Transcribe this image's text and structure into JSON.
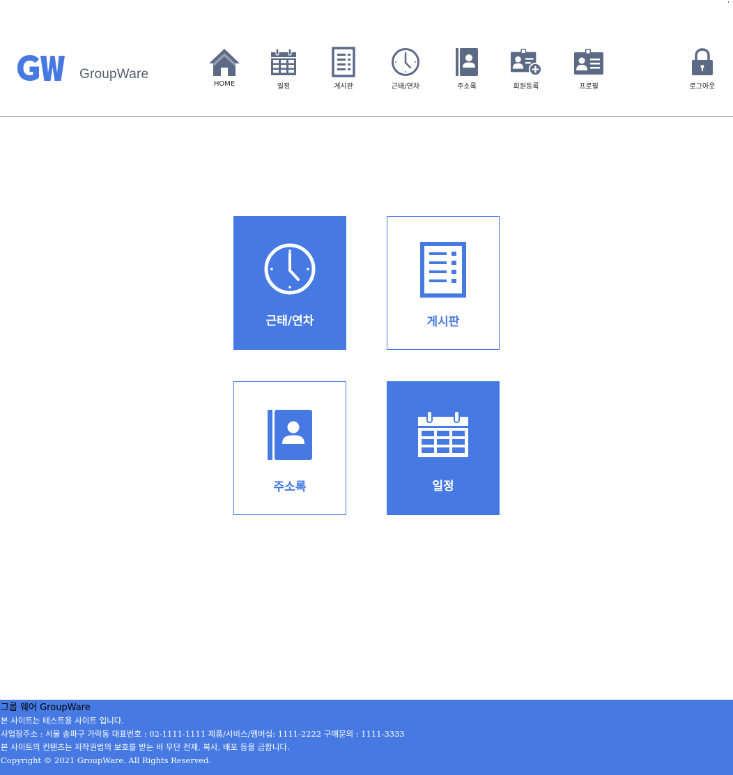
{
  "header": {
    "logo": {
      "mark": "GW",
      "text": "GroupWare"
    },
    "nav": [
      {
        "label": "HOME",
        "icon": "home-icon"
      },
      {
        "label": "일정",
        "icon": "calendar-icon"
      },
      {
        "label": "게시판",
        "icon": "board-list-icon"
      },
      {
        "label": "근태/연차",
        "icon": "clock-icon"
      },
      {
        "label": "주소록",
        "icon": "address-book-icon"
      },
      {
        "label": "회원등록",
        "icon": "add-member-icon"
      },
      {
        "label": "프로필",
        "icon": "profile-card-icon"
      }
    ],
    "logout": {
      "label": "로그아웃",
      "icon": "lock-icon"
    }
  },
  "tiles": [
    {
      "label": "근태/연차",
      "icon": "clock-icon",
      "style": "filled"
    },
    {
      "label": "게시판",
      "icon": "board-list-icon",
      "style": "outline"
    },
    {
      "label": "주소록",
      "icon": "address-book-icon",
      "style": "outline"
    },
    {
      "label": "일정",
      "icon": "calendar-icon",
      "style": "filled"
    }
  ],
  "footer": {
    "title": "그룹 웨어 GroupWare",
    "lines": [
      "본 사이트는 테스트용 사이트 입니다.",
      "사업장주소 : 서울 송파구 가락동 대표번호 : 02-1111-1111 제품/서비스/멤버십: 1111-2222 구매문의 : 1111-3333",
      "본 사이트의 컨텐츠는 저작권법의 보호를 받는 바 무단 전재, 복사, 배포 등을 금합니다.",
      "Copyright © 2021 GroupWare. All Rights Reserved."
    ]
  },
  "colors": {
    "accent": "#4679e2",
    "nav_icon": "#5d6a85",
    "rule": "#9a9a9a"
  }
}
